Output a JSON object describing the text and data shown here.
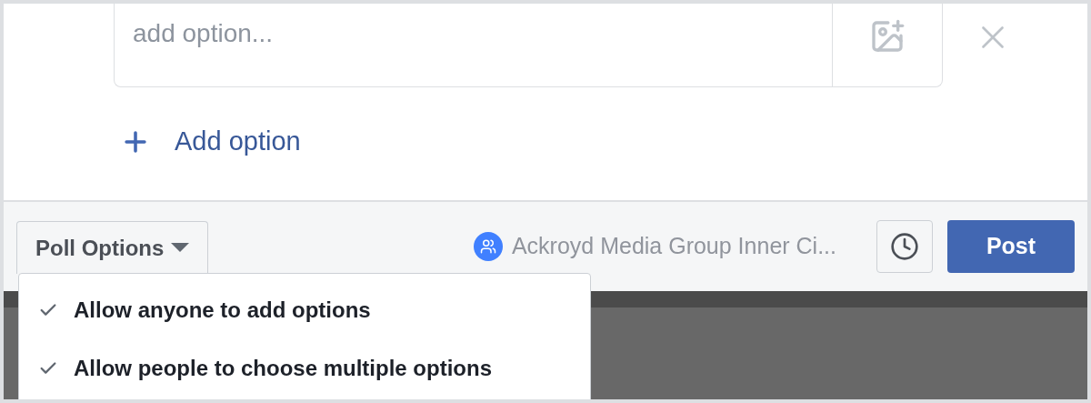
{
  "option_field": {
    "placeholder": "add option..."
  },
  "add_option": {
    "label": "Add option"
  },
  "footer": {
    "poll_options": {
      "label": "Poll Options",
      "expanded": true
    },
    "audience": "Ackroyd Media Group Inner Ci...",
    "post": "Post"
  },
  "menu": [
    {
      "label": "Allow anyone to add options",
      "checked": true
    },
    {
      "label": "Allow people to choose multiple options",
      "checked": true
    }
  ]
}
